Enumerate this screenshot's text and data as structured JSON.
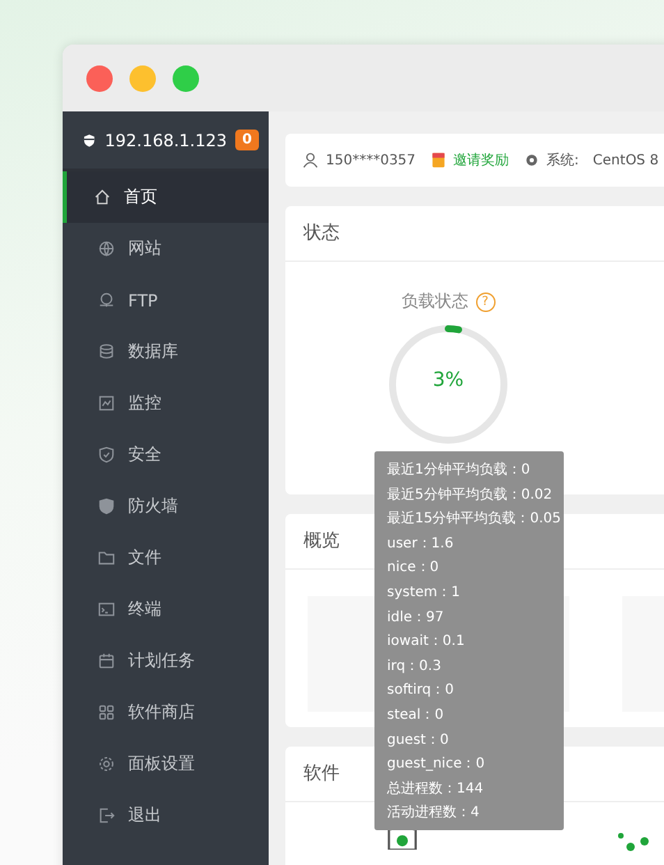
{
  "sidebar": {
    "host": "192.168.1.123",
    "badge": "0",
    "items": [
      {
        "label": "首页",
        "selected": true
      },
      {
        "label": "网站",
        "selected": false
      },
      {
        "label": "FTP",
        "selected": false
      },
      {
        "label": "数据库",
        "selected": false
      },
      {
        "label": "监控",
        "selected": false
      },
      {
        "label": "安全",
        "selected": false
      },
      {
        "label": "防火墙",
        "selected": false
      },
      {
        "label": "文件",
        "selected": false
      },
      {
        "label": "终端",
        "selected": false
      },
      {
        "label": "计划任务",
        "selected": false
      },
      {
        "label": "软件商店",
        "selected": false
      },
      {
        "label": "面板设置",
        "selected": false
      },
      {
        "label": "退出",
        "selected": false
      }
    ]
  },
  "info_bar": {
    "user": "150****0357",
    "invite": "邀请奖励",
    "system_label": "系统:",
    "system_value": "CentOS 8"
  },
  "status": {
    "title": "状态",
    "load": {
      "label": "负载状态",
      "help": "?",
      "value": "3%",
      "level": 0.03
    },
    "tooltip": [
      "最近1分钟平均负载：0",
      "最近5分钟平均负载：0.02",
      "最近15分钟平均负载：0.05",
      "user：1.6",
      "nice：0",
      "system：1",
      "idle：97",
      "iowait：0.1",
      "irq：0.3",
      "softirq：0",
      "steal：0",
      "guest：0",
      "guest_nice：0",
      "总进程数：144",
      "活动进程数：4"
    ]
  },
  "overview": {
    "title": "概览"
  },
  "software": {
    "title": "软件"
  }
}
